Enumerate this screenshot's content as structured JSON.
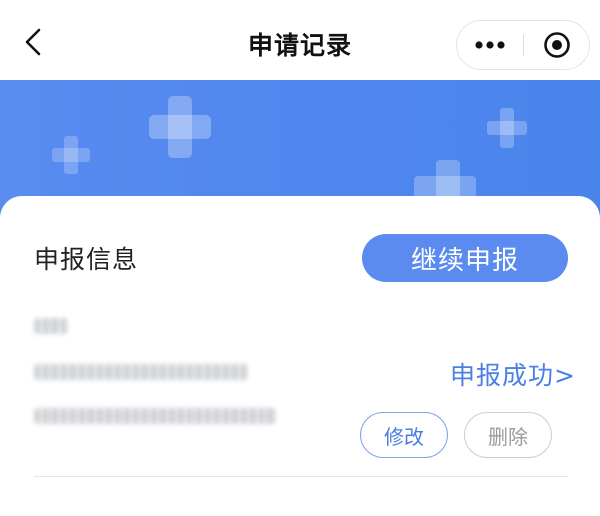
{
  "header": {
    "title": "申请记录",
    "back_icon": "chevron-left-icon",
    "more_icon": "more-dots-icon",
    "close_icon": "target-close-icon"
  },
  "banner": {
    "color_left": "#5a8cf0",
    "color_right": "#4a85eb",
    "decoration_icon": "medical-cross-icon"
  },
  "record": {
    "section_title": "申报信息",
    "continue_label": "继续申报",
    "status_label": "申报成功>",
    "edit_label": "修改",
    "delete_label": "删除"
  },
  "colors": {
    "accent": "#5b8bef",
    "link": "#4a80e6"
  }
}
